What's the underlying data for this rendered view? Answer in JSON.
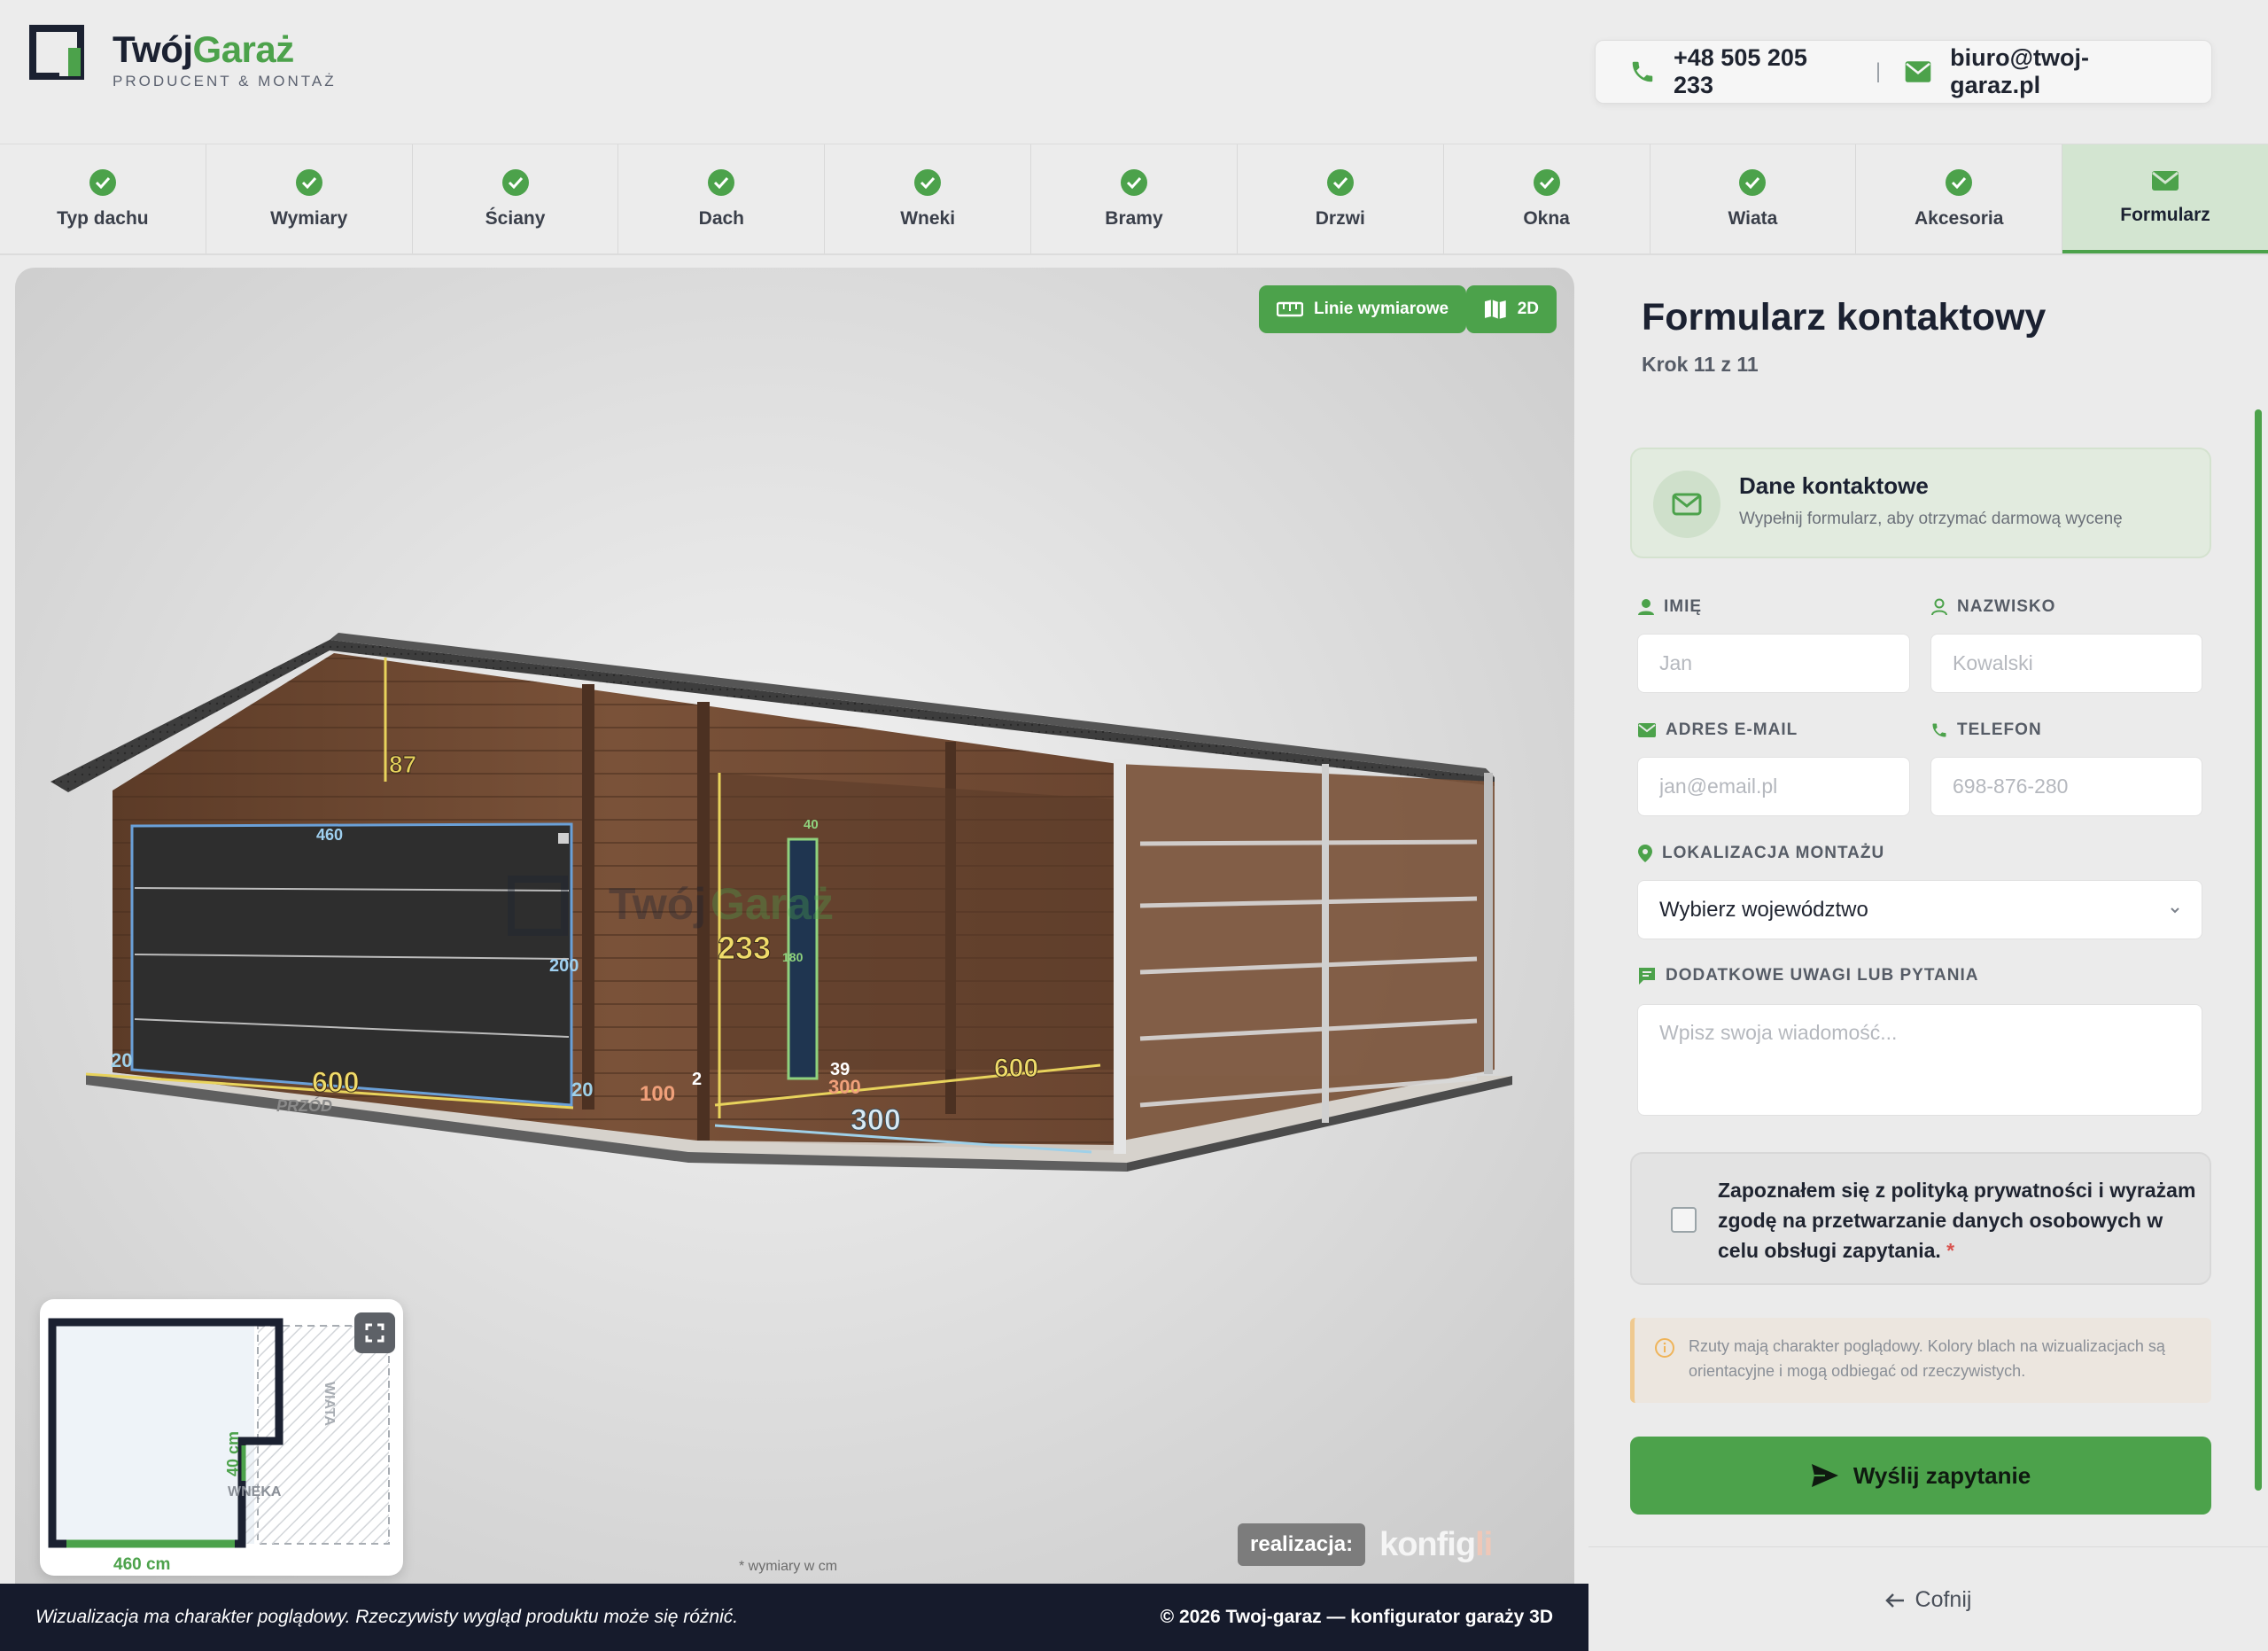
{
  "brand": {
    "name_dark": "Twój",
    "name_green": "Garaż",
    "tagline": "PRODUCENT & MONTAŻ"
  },
  "contact": {
    "phone": "+48 505 205 233",
    "separator": "|",
    "email": "biuro@twoj-garaz.pl"
  },
  "steps": [
    {
      "label": "Typ dachu",
      "status": "done"
    },
    {
      "label": "Wymiary",
      "status": "done"
    },
    {
      "label": "Ściany",
      "status": "done"
    },
    {
      "label": "Dach",
      "status": "done"
    },
    {
      "label": "Wneki",
      "status": "done"
    },
    {
      "label": "Bramy",
      "status": "done"
    },
    {
      "label": "Drzwi",
      "status": "done"
    },
    {
      "label": "Okna",
      "status": "done"
    },
    {
      "label": "Wiata",
      "status": "done"
    },
    {
      "label": "Akcesoria",
      "status": "done"
    },
    {
      "label": "Formularz",
      "status": "active"
    }
  ],
  "viewer": {
    "btn_dimensions": "Linie wymiarowe",
    "btn_2d": "2D",
    "units_note": "* wymiary w cm",
    "badge_real": "realizacja:",
    "badge_konf": "konfig",
    "badge_konf_accent": "li",
    "watermark_dark": "Twój",
    "watermark_green": "Garaż",
    "dims": {
      "roof_height": "87",
      "gate_width_top": "460",
      "gate_height": "200",
      "wall_height": "233",
      "door_width": "40",
      "door_height": "180",
      "front_length": "600",
      "side_length": "600",
      "left_gap": "20",
      "gate_right_gap": "20",
      "door_offset": "100",
      "small_gap": "2",
      "door_right": "39",
      "niche_depth": "300",
      "niche_width": "300",
      "front_label": "PRZÓD"
    },
    "minimap": {
      "width_label": "460 cm",
      "niche_label": "WNĘKA",
      "niche_depth": "40 cm",
      "carport_label": "WIATA"
    }
  },
  "footer": {
    "disclaimer": "Wizualizacja ma charakter poglądowy. Rzeczywisty wygląd produktu może się różnić.",
    "copyright": "© 2026 Twoj-garaz — konfigurator garaży 3D"
  },
  "form": {
    "title": "Formularz kontaktowy",
    "step": "Krok 11 z 11",
    "card_title": "Dane kontaktowe",
    "card_sub": "Wypełnij formularz, aby otrzymać darmową wycenę",
    "first_name_label": "IMIĘ",
    "first_name_placeholder": "Jan",
    "last_name_label": "NAZWISKO",
    "last_name_placeholder": "Kowalski",
    "email_label": "ADRES E-MAIL",
    "email_placeholder": "jan@email.pl",
    "phone_label": "TELEFON",
    "phone_placeholder": "698-876-280",
    "location_label": "LOKALIZACJA MONTAŻU",
    "location_value": "Wybierz województwo",
    "notes_label": "DODATKOWE UWAGI LUB PYTANIA",
    "notes_placeholder": "Wpisz swoja wiadomość...",
    "consent_text": "Zapoznałem się z polityką prywatności i wyrażam zgodę na przetwarzanie danych osobowych w celu obsługi zapytania.",
    "consent_required": "*",
    "note": "Rzuty mają charakter poglądowy. Kolory blach na wizualizacjach są orientacyjne i mogą odbiegać od rzeczywistych.",
    "submit": "Wyślij zapytanie",
    "back": "Cofnij"
  },
  "colors": {
    "accent": "#4ca24b",
    "navy": "#1b2131",
    "wood": "#6b4630",
    "gate": "#2b2b2b"
  }
}
